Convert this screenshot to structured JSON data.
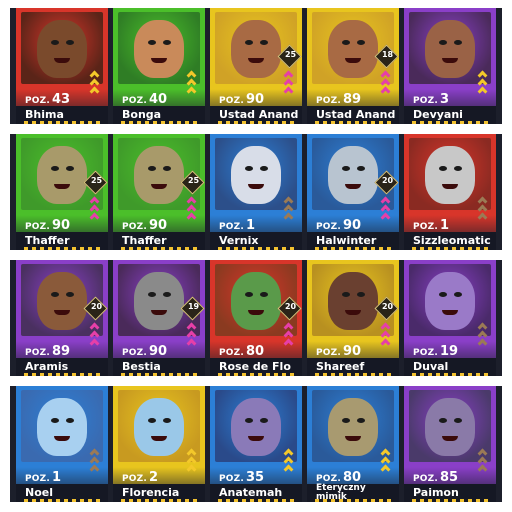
{
  "colors": {
    "red": "#d8352a",
    "green": "#4bbf2a",
    "yellow": "#e8c51e",
    "blue": "#2c7fd6",
    "purple": "#8a3fc8",
    "chev_yellow": "#f3c82a",
    "chev_pink": "#e63fa8",
    "chev_brown": "#9b7a55"
  },
  "rows": [
    [
      {
        "poz_label": "POZ.",
        "level": "43",
        "name": "Bhima",
        "color": "#d8352a",
        "badge": "",
        "chevrons": "yellow",
        "face": "#7a4a2c",
        "bg": "#5a2418",
        "icon": "portrait-bearded-warrior-icon"
      },
      {
        "poz_label": "POZ.",
        "level": "40",
        "name": "Bonga",
        "color": "#4bbf2a",
        "badge": "",
        "chevrons": "yellow",
        "face": "#c98a5a",
        "bg": "#2f7d25",
        "icon": "portrait-old-man-icon"
      },
      {
        "poz_label": "POZ.",
        "level": "90",
        "name": "Ustad Anand",
        "color": "#e8c51e",
        "badge": "25",
        "chevrons": "pink",
        "face": "#a86a44",
        "bg": "#d0a226",
        "icon": "portrait-mustached-man-icon"
      },
      {
        "poz_label": "POZ.",
        "level": "89",
        "name": "Ustad Anand",
        "color": "#e8c51e",
        "badge": "18",
        "chevrons": "pink",
        "face": "#a86a44",
        "bg": "#d0a226",
        "icon": "portrait-mustached-man-icon"
      },
      {
        "poz_label": "POZ.",
        "level": "3",
        "name": "Devyani",
        "color": "#8a3fc8",
        "badge": "",
        "chevrons": "yellow",
        "face": "#9a6246",
        "bg": "#4a2a5a",
        "icon": "portrait-woman-icon"
      }
    ],
    [
      {
        "poz_label": "POZ.",
        "level": "90",
        "name": "Thaffer",
        "color": "#4bbf2a",
        "badge": "25",
        "chevrons": "pink",
        "face": "#a89a6a",
        "bg": "#3f9a2a",
        "icon": "portrait-cat-warrior-icon"
      },
      {
        "poz_label": "POZ.",
        "level": "90",
        "name": "Thaffer",
        "color": "#4bbf2a",
        "badge": "25",
        "chevrons": "pink",
        "face": "#a89a6a",
        "bg": "#3f9a2a",
        "icon": "portrait-cat-warrior-icon"
      },
      {
        "poz_label": "POZ.",
        "level": "1",
        "name": "Vernix",
        "color": "#2c7fd6",
        "badge": "",
        "chevrons": "brown",
        "face": "#d8dde8",
        "bg": "#2c4f8a",
        "icon": "portrait-snow-leopard-icon"
      },
      {
        "poz_label": "POZ.",
        "level": "90",
        "name": "Halwinter",
        "color": "#2c7fd6",
        "badge": "20",
        "chevrons": "pink",
        "face": "#b8c4d0",
        "bg": "#2a5a9a",
        "icon": "portrait-knight-helmet-icon"
      },
      {
        "poz_label": "POZ.",
        "level": "1",
        "name": "Sizzleomatic",
        "color": "#d8352a",
        "badge": "",
        "chevrons": "brown",
        "face": "#c8c8c8",
        "bg": "#8a2a22",
        "icon": "portrait-robot-icon"
      }
    ],
    [
      {
        "poz_label": "POZ.",
        "level": "89",
        "name": "Aramis",
        "color": "#8a3fc8",
        "badge": "20",
        "chevrons": "pink",
        "face": "#8a5a3a",
        "bg": "#4a3060",
        "icon": "portrait-musketeer-icon"
      },
      {
        "poz_label": "POZ.",
        "level": "90",
        "name": "Bestia",
        "color": "#8a3fc8",
        "badge": "19",
        "chevrons": "pink",
        "face": "#8a8a8a",
        "bg": "#4a2a5a",
        "icon": "portrait-beast-icon"
      },
      {
        "poz_label": "POZ.",
        "level": "80",
        "name": "Rose de Flo",
        "color": "#d8352a",
        "badge": "20",
        "chevrons": "pink",
        "face": "#5a9a4a",
        "bg": "#8a3a20",
        "icon": "portrait-green-woman-icon"
      },
      {
        "poz_label": "POZ.",
        "level": "90",
        "name": "Shareef",
        "color": "#e8c51e",
        "badge": "20",
        "chevrons": "pink",
        "face": "#6a4030",
        "bg": "#b89020",
        "icon": "portrait-surprised-woman-icon"
      },
      {
        "poz_label": "POZ.",
        "level": "19",
        "name": "Duval",
        "color": "#8a3fc8",
        "badge": "",
        "chevrons": "brown",
        "face": "#9a7ac8",
        "bg": "#4a2a6a",
        "icon": "portrait-purple-man-icon"
      }
    ],
    [
      {
        "poz_label": "POZ.",
        "level": "1",
        "name": "Noel",
        "color": "#2c7fd6",
        "badge": "",
        "chevrons": "brown",
        "face": "#a8d0f0",
        "bg": "#3a6ab0",
        "icon": "portrait-snowman-icon"
      },
      {
        "poz_label": "POZ.",
        "level": "2",
        "name": "Florencia",
        "color": "#e8c51e",
        "badge": "",
        "chevrons": "yellow",
        "face": "#9ac8e8",
        "bg": "#c89a20",
        "icon": "portrait-penguin-icon"
      },
      {
        "poz_label": "POZ.",
        "level": "35",
        "name": "Anatemah",
        "color": "#2c7fd6",
        "badge": "",
        "chevrons": "yellow",
        "face": "#8a7ab8",
        "bg": "#2a4a8a",
        "icon": "portrait-sorceress-icon"
      },
      {
        "poz_label": "POZ.",
        "level": "80",
        "name": "Eteryczny mimik",
        "color": "#2c7fd6",
        "badge": "",
        "chevrons": "yellow",
        "face": "#a89a70",
        "bg": "#2a5a9a",
        "icon": "portrait-chest-mimic-icon"
      },
      {
        "poz_label": "POZ.",
        "level": "85",
        "name": "Paimon",
        "color": "#8a3fc8",
        "badge": "",
        "chevrons": "brown",
        "face": "#8a7aa8",
        "bg": "#4a3a6a",
        "icon": "portrait-demon-king-icon"
      }
    ]
  ]
}
